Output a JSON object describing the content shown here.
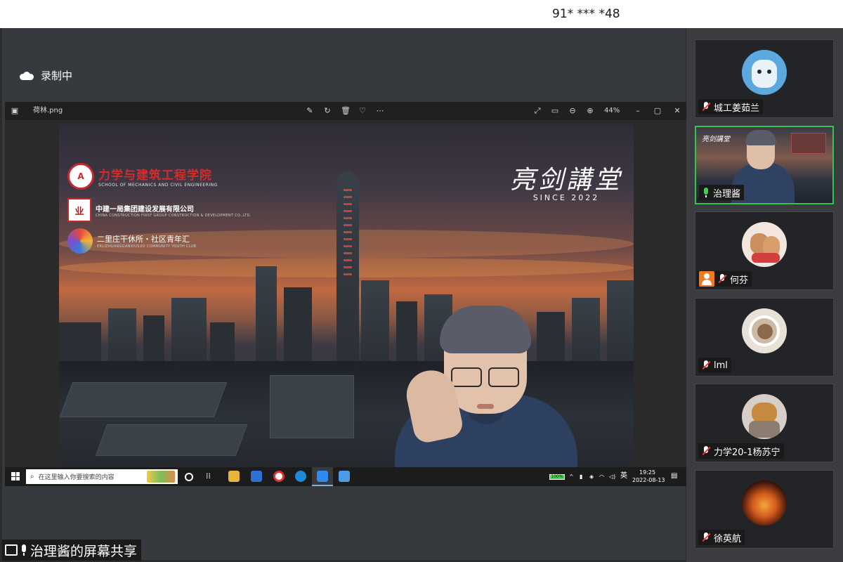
{
  "meeting": {
    "id_masked": "91* *** *48",
    "recording_label": "录制中",
    "share_label": "治理酱的屏幕共享"
  },
  "viewer": {
    "file_name": "荷林.png",
    "zoom": "44%"
  },
  "slide": {
    "school_name_cn": "力学与建筑工程学院",
    "school_name_en": "SCHOOL OF MECHANICS AND CIVIL ENGINEERING",
    "company_cn": "中建一局集团建设发展有限公司",
    "company_en": "CHINA CONSTRUCTION FIRST GROUP CONSTRUCTION & DEVELOPMENT CO.,LTD.",
    "community_cn": "二里庄干休所・社区青年汇",
    "community_en": "ERLIZHUANGGANXIUSUO COMMUNITY YOUTH CLUB",
    "brand_title": "亮剑講堂",
    "brand_since": "SINCE 2022"
  },
  "taskbar": {
    "search_placeholder": "在这里输入你要搜索的内容",
    "ime": "英",
    "time": "19:25",
    "date": "2022-08-13",
    "battery": "100%"
  },
  "participants": [
    {
      "name": "城工姜茹兰",
      "audio": "muted",
      "tile": "avatar"
    },
    {
      "name": "治理酱",
      "audio": "speaking",
      "tile": "video"
    },
    {
      "name": "何芬",
      "audio": "muted",
      "tile": "avatar"
    },
    {
      "name": "lml",
      "audio": "muted",
      "tile": "avatar"
    },
    {
      "name": "力学20-1杨苏宁",
      "audio": "muted",
      "tile": "avatar"
    },
    {
      "name": "徐英航",
      "audio": "muted",
      "tile": "avatar"
    }
  ],
  "colors": {
    "speaking_border": "#36c24b",
    "muted_slash": "#e5413a",
    "logo_red": "#c8282c"
  }
}
